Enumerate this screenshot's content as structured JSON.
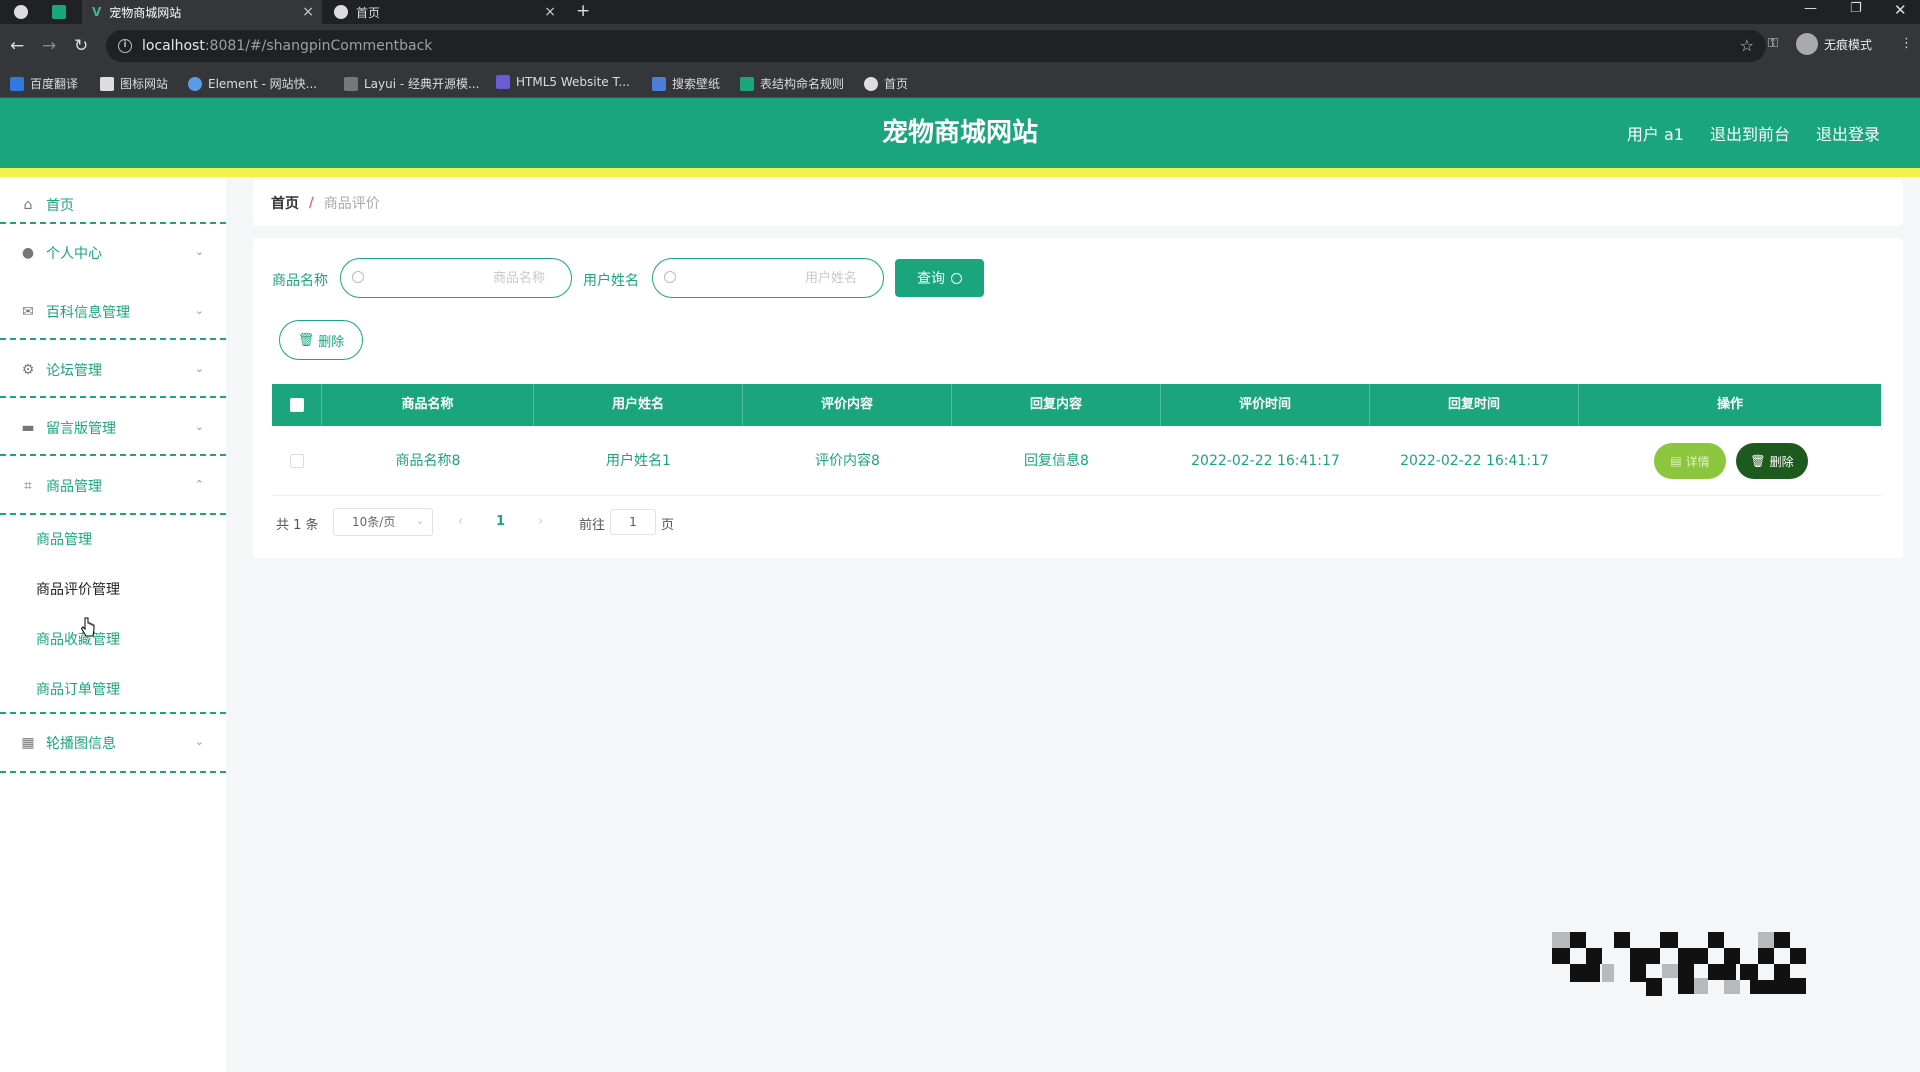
{
  "browser": {
    "tabs": [
      {
        "title": "宠物商城网站",
        "active": true
      },
      {
        "title": "首页",
        "active": false
      }
    ],
    "url_host": "localhost",
    "url_path": ":8081/#/shangpinCommentback",
    "incognito_label": "无痕模式",
    "bookmarks": [
      "百度翻译",
      "图标网站",
      "Element - 网站快...",
      "Layui - 经典开源模...",
      "HTML5 Website T...",
      "搜索壁纸",
      "表结构命名规则",
      "首页"
    ]
  },
  "header": {
    "title": "宠物商城网站",
    "links": [
      "用户 a1",
      "退出到前台",
      "退出登录"
    ]
  },
  "sidebar": {
    "items": [
      {
        "label": "首页",
        "icon": "home-icon"
      },
      {
        "label": "个人中心",
        "icon": "user-icon"
      },
      {
        "label": "百科信息管理",
        "icon": "mail-icon"
      },
      {
        "label": "论坛管理",
        "icon": "settings-icon"
      },
      {
        "label": "留言版管理",
        "icon": "inbox-icon"
      },
      {
        "label": "商品管理",
        "icon": "crop-icon"
      },
      {
        "label": "轮播图信息",
        "icon": "grid-icon"
      }
    ],
    "sub_items": [
      "商品管理",
      "商品评价管理",
      "商品收藏管理",
      "商品订单管理"
    ]
  },
  "breadcrumb": {
    "home": "首页",
    "separator": "/",
    "current": "商品评价"
  },
  "search": {
    "product_label": "商品名称",
    "product_placeholder": "商品名称",
    "user_label": "用户姓名",
    "user_placeholder": "用户姓名",
    "query_label": "查询"
  },
  "toolbar": {
    "delete_label": "删除"
  },
  "table": {
    "columns": [
      "商品名称",
      "用户姓名",
      "评价内容",
      "回复内容",
      "评价时间",
      "回复时间",
      "操作"
    ],
    "rows": [
      {
        "product": "商品名称8",
        "user": "用户姓名1",
        "comment": "评价内容8",
        "reply": "回复信息8",
        "comment_time": "2022-02-22 16:41:17",
        "reply_time": "2022-02-22 16:41:17",
        "detail_label": "详情",
        "delete_label": "删除"
      }
    ]
  },
  "pagination": {
    "total": "共 1 条",
    "page_size": "10条/页",
    "current_page": "1",
    "goto_label": "前往",
    "goto_value": "1",
    "page_suffix": "页"
  },
  "colors": {
    "primary": "#1ba57d",
    "accent_line": "#f2f24d",
    "detail_btn": "#8cc63f",
    "delete_btn": "#1e5a1e"
  }
}
